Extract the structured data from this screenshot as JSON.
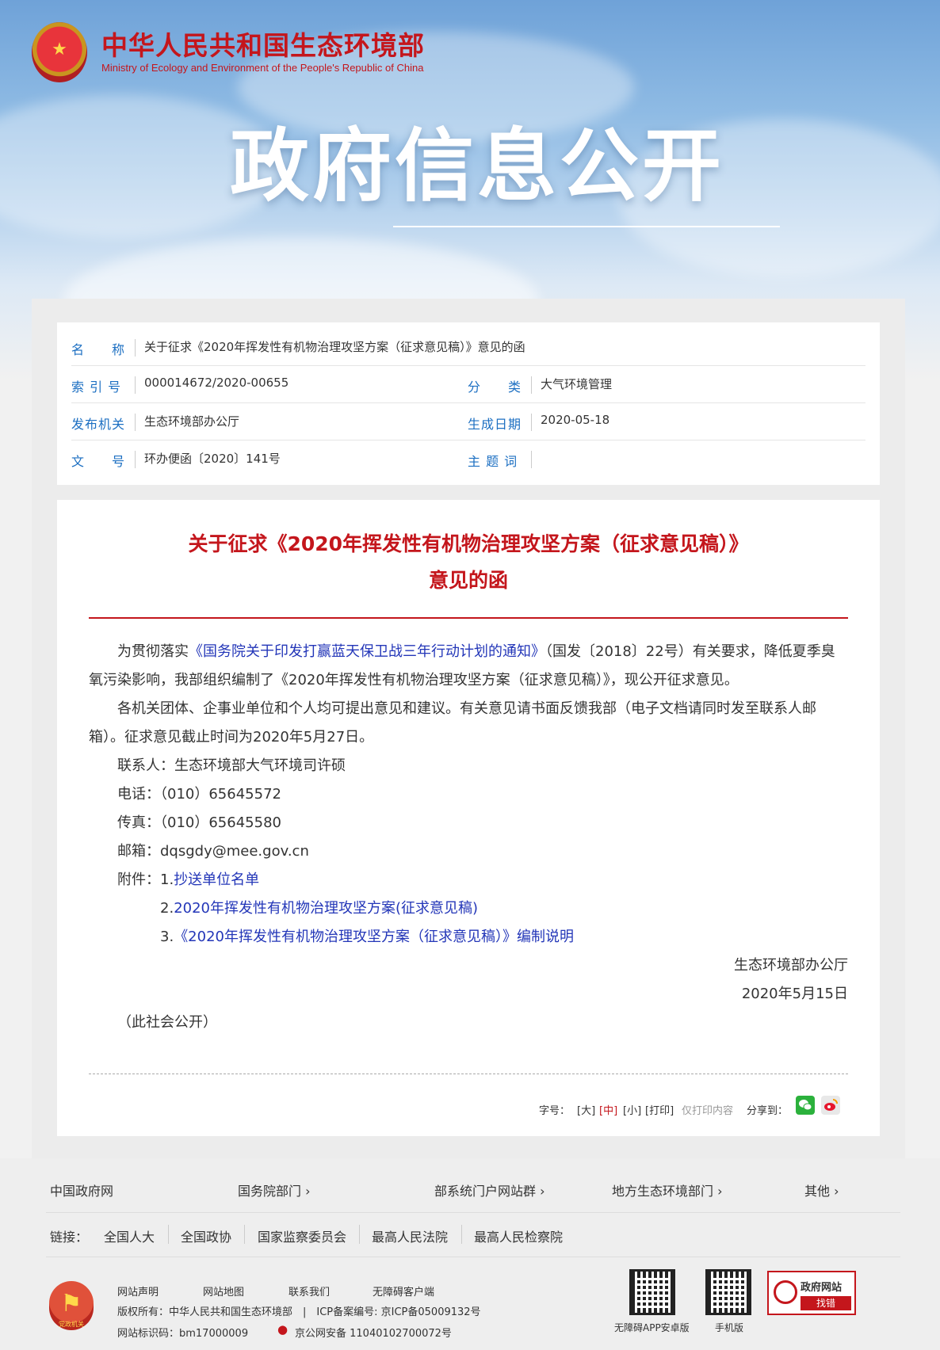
{
  "colors": {
    "brand_red": "#c4161c",
    "link_blue": "#2336b8",
    "label_blue": "#1c6fc2"
  },
  "header": {
    "site_name_cn": "中华人民共和国生态环境部",
    "site_name_en": "Ministry of Ecology and Environment of the People's Republic of China",
    "banner_title": "政府信息公开"
  },
  "meta": {
    "name_label": "名　　称",
    "name_value": "关于征求《2020年挥发性有机物治理攻坚方案（征求意见稿）》意见的函",
    "index_label": "索 引 号",
    "index_value": "000014672/2020-00655",
    "category_label": "分　　类",
    "category_value": "大气环境管理",
    "issuer_label": "发布机关",
    "issuer_value": "生态环境部办公厅",
    "date_label": "生成日期",
    "date_value": "2020-05-18",
    "docno_label": "文　　号",
    "docno_value": "环办便函〔2020〕141号",
    "keywords_label": "主 题 词",
    "keywords_value": ""
  },
  "document": {
    "title_line1": "关于征求《2020年挥发性有机物治理攻坚方案（征求意见稿）》",
    "title_line2": "意见的函",
    "p1_prefix": "为贯彻落实",
    "p1_link": "《国务院关于印发打赢蓝天保卫战三年行动计划的通知》",
    "p1_suffix": "（国发〔2018〕22号）有关要求，降低夏季臭",
    "p1_line2": "氧污染影响，我部组织编制了《2020年挥发性有机物治理攻坚方案（征求意见稿）》，现公开征求意见。",
    "p2_line1": "各机关团体、企事业单位和个人均可提出意见和建议。有关意见请书面反馈我部（电子文档请同时发至联系人邮",
    "p2_line2": "箱）。征求意见截止时间为2020年5月27日。",
    "contact": "联系人：生态环境部大气环境司许硕",
    "phone": "电话：（010）65645572",
    "fax": "传真：（010）65645580",
    "email": "邮箱：dqsgdy@mee.gov.cn",
    "attach_label": "附件：",
    "attach1_num": "1.",
    "attach1": "抄送单位名单",
    "attach2_num": "2.",
    "attach2": "2020年挥发性有机物治理攻坚方案(征求意见稿)",
    "attach3_num": "3.",
    "attach3": "《2020年挥发性有机物治理攻坚方案（征求意见稿）》编制说明",
    "signer": "生态环境部办公厅",
    "sign_date": "2020年5月15日",
    "disclosure": "（此社会公开）"
  },
  "tools": {
    "font_label": "字号：",
    "large": "[大]",
    "medium": "[中]",
    "small": "[小]",
    "print": "[打印]",
    "print_note": "仅打印内容",
    "share_label": "分享到："
  },
  "footer": {
    "nav": [
      "中国政府网",
      "国务院部门 ›",
      "部系统门户网站群 ›",
      "地方生态环境部门 ›",
      "其他 ›"
    ],
    "links_label": "链接：",
    "links": [
      "全国人大",
      "全国政协",
      "国家监察委员会",
      "最高人民法院",
      "最高人民检察院"
    ],
    "bottom_links": [
      "网站声明",
      "网站地图",
      "联系我们",
      "无障碍客户端"
    ],
    "copyright": "版权所有：中华人民共和国生态环境部　|　ICP备案编号: 京ICP备05009132号",
    "site_id": "网站标识码：bm17000009",
    "police": "京公网安备 11040102700072号",
    "party_badge": "党政机关",
    "qr1_caption": "无障碍APP安卓版",
    "qr2_caption": "手机版",
    "zf_title": "政府网站",
    "zf_sub": "找错"
  }
}
